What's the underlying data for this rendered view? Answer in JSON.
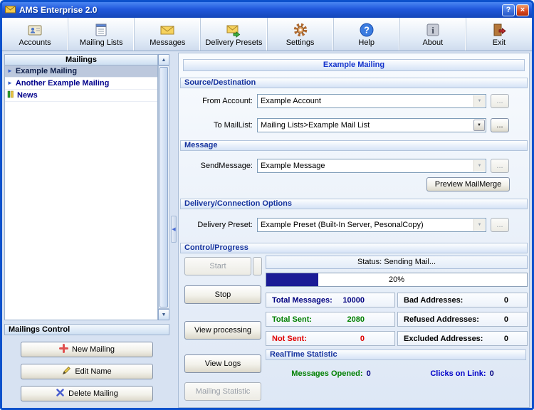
{
  "window": {
    "title": "AMS Enterprise 2.0"
  },
  "titlebar": {
    "help_glyph": "?",
    "close_glyph": "×"
  },
  "toolbar": {
    "items": [
      {
        "label": "Accounts",
        "icon": "accounts-icon"
      },
      {
        "label": "Mailing Lists",
        "icon": "mailing-lists-icon"
      },
      {
        "label": "Messages",
        "icon": "messages-icon"
      },
      {
        "label": "Delivery Presets",
        "icon": "delivery-presets-icon"
      },
      {
        "label": "Settings",
        "icon": "settings-icon"
      },
      {
        "label": "Help",
        "icon": "help-icon"
      },
      {
        "label": "About",
        "icon": "about-icon"
      },
      {
        "label": "Exit",
        "icon": "exit-icon"
      }
    ]
  },
  "sidebar": {
    "header": "Mailings",
    "items": [
      {
        "label": "Example Mailing",
        "icon": "arrow-icon",
        "selected": true
      },
      {
        "label": "Another Example Mailing",
        "icon": "arrow-icon",
        "selected": false
      },
      {
        "label": "News",
        "icon": "news-icon",
        "selected": false
      }
    ],
    "control": {
      "header": "Mailings Control",
      "buttons": [
        {
          "label": "New Mailing",
          "icon": "plus-icon"
        },
        {
          "label": "Edit Name",
          "icon": "pen-icon"
        },
        {
          "label": "Delete Mailing",
          "icon": "cross-icon"
        }
      ]
    }
  },
  "main": {
    "title": "Example Mailing",
    "source": {
      "title": "Source/Destination",
      "from_label": "From Account:",
      "from_value": "Example Account",
      "to_label": "To MailList:",
      "to_value": "Mailing Lists>Example Mail List"
    },
    "message": {
      "title": "Message",
      "send_label": "SendMessage:",
      "send_value": "Example Message",
      "preview_label": "Preview MailMerge"
    },
    "delivery": {
      "title": "Delivery/Connection Options",
      "preset_label": "Delivery Preset:",
      "preset_value": "Example Preset (Built-In Server, PesonalCopy)"
    },
    "control": {
      "title": "Control/Progress",
      "buttons": [
        {
          "label": "Start",
          "disabled": true
        },
        {
          "label": "Stop",
          "disabled": false
        },
        {
          "label": "View processing",
          "disabled": false
        },
        {
          "label": "View Logs",
          "disabled": false
        },
        {
          "label": "Mailing Statistic",
          "disabled": true
        }
      ],
      "status": "Status: Sending Mail...",
      "progress": {
        "percent": 20,
        "label": "20%"
      },
      "stats": {
        "total_messages": {
          "label": "Total Messages:",
          "value": "10000"
        },
        "bad_addresses": {
          "label": "Bad Addresses:",
          "value": "0"
        },
        "total_sent": {
          "label": "Total Sent:",
          "value": "2080"
        },
        "refused_addresses": {
          "label": "Refused Addresses:",
          "value": "0"
        },
        "not_sent": {
          "label": "Not Sent:",
          "value": "0"
        },
        "excluded_addresses": {
          "label": "Excluded Addresses:",
          "value": "0"
        }
      },
      "realtime": {
        "title": "RealTime Statistic",
        "opened_label": "Messages Opened:",
        "opened_value": "0",
        "clicks_label": "Clicks on Link:",
        "clicks_value": "0"
      }
    }
  },
  "ui": {
    "browse_label": "...",
    "dropdown_glyph": "▼",
    "scroll_up_glyph": "▲",
    "scroll_down_glyph": "▼",
    "splitter_glyph": "◀",
    "list_arrow_glyph": "►"
  },
  "colors": {
    "accent_navy": "#000080",
    "green": "#008000",
    "red": "#e00000",
    "title_blue": "#1433cc",
    "link_blue": "#0000c8",
    "progress_fill": "#1b1b96"
  }
}
